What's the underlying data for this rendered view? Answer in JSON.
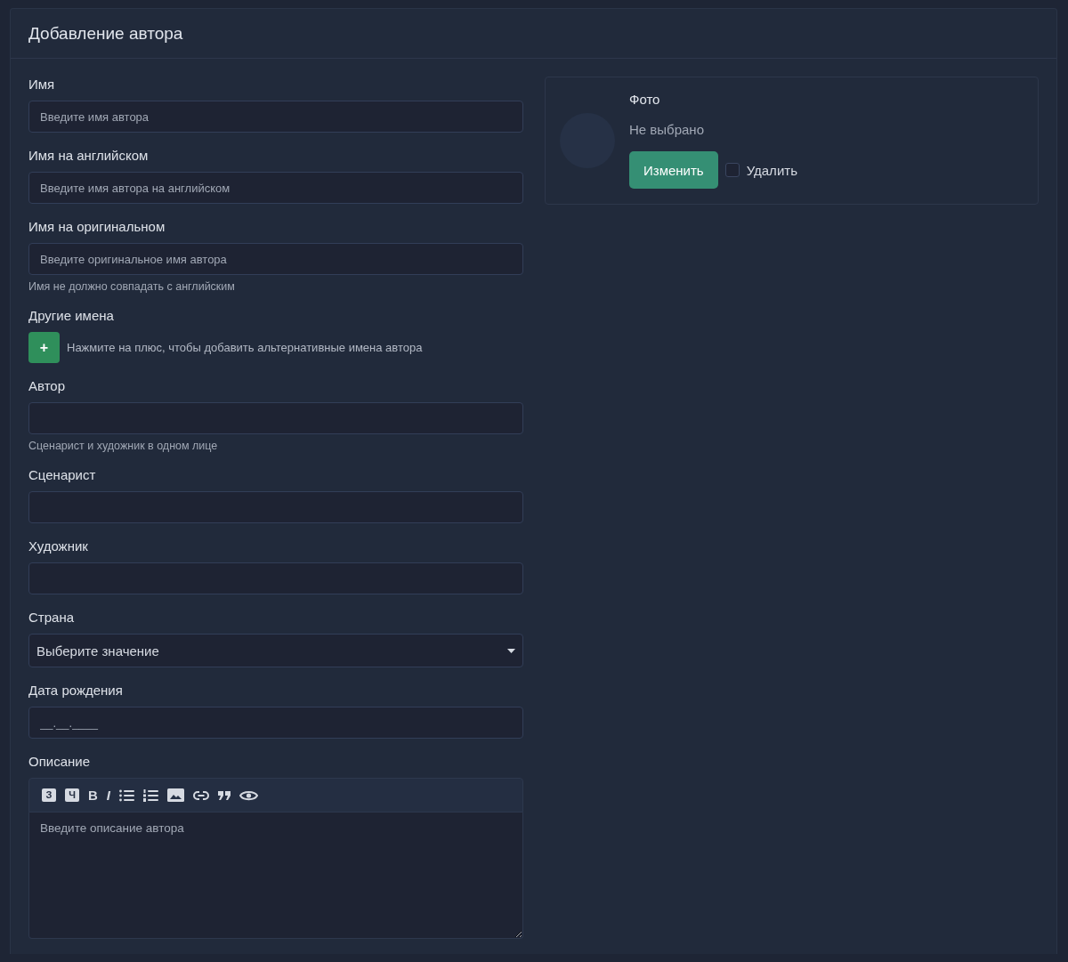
{
  "title": "Добавление автора",
  "fields": [
    {
      "kind": "text",
      "label": "Имя",
      "placeholder": "Введите имя автора"
    },
    {
      "kind": "text",
      "label": "Имя на английском",
      "placeholder": "Введите имя автора на английском"
    },
    {
      "kind": "text",
      "label": "Имя на оригинальном",
      "placeholder": "Введите оригинальное имя автора",
      "help": "Имя не должно совпадать с английским"
    },
    {
      "kind": "add-list",
      "label": "Другие имена",
      "button": "+",
      "hint": "Нажмите на плюс, чтобы добавить альтернативные имена автора"
    },
    {
      "kind": "text",
      "label": "Автор",
      "help": "Сценарист и художник в одном лице"
    },
    {
      "kind": "text",
      "label": "Сценарист"
    },
    {
      "kind": "text",
      "label": "Художник"
    },
    {
      "kind": "select",
      "label": "Страна",
      "value": "Выберите значение"
    },
    {
      "kind": "text",
      "label": "Дата рождения",
      "placeholder": "__.__.____"
    },
    {
      "kind": "editor",
      "label": "Описание",
      "placeholder": "Введите описание автора",
      "toolbar": [
        {
          "kind": "heading",
          "label": "З"
        },
        {
          "kind": "heading",
          "label": "Ч"
        },
        {
          "kind": "bold",
          "label": "B"
        },
        {
          "kind": "italic",
          "label": "I"
        },
        {
          "kind": "list"
        },
        {
          "kind": "ordered-list"
        },
        {
          "kind": "image"
        },
        {
          "kind": "link"
        },
        {
          "kind": "quote"
        },
        {
          "kind": "preview"
        }
      ]
    }
  ],
  "photo": {
    "title": "Фото",
    "status": "Не выбрано",
    "button": "Изменить",
    "delete": {
      "label": "Удалить",
      "checked": false
    }
  }
}
